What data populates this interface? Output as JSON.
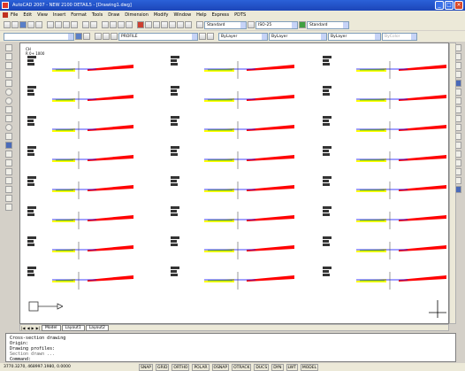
{
  "window": {
    "title": "AutoCAD 2007 - NEW 2100 DETAIL5 - [Drawing1.dwg]"
  },
  "menu": [
    "File",
    "Edit",
    "View",
    "Insert",
    "Format",
    "Tools",
    "Draw",
    "Dimension",
    "Modify",
    "Window",
    "Help",
    "Express",
    "PDTS"
  ],
  "styles": {
    "text_style": "Standard",
    "dim_style": "ISO-25",
    "table_style": "Standard"
  },
  "properties": {
    "layer": "PROFILE",
    "color": "ByLayer",
    "linetype": "ByLayer",
    "lineweight": "ByLayer",
    "plot_style": "ByColor"
  },
  "drawing": {
    "caption_line1": "CH",
    "caption_line2": "R 0+ 1000"
  },
  "layout_tabs": [
    "Model",
    "Layout1",
    "Layout2"
  ],
  "command_history": [
    "Cross-section drawing",
    "Origin:",
    "Drawing profiles:",
    "Section drawn ...",
    "Command:"
  ],
  "status": {
    "coords": "3770.3270, 468997.1980, 0.0000",
    "toggles": [
      "SNAP",
      "GRID",
      "ORTHO",
      "POLAR",
      "OSNAP",
      "OTRACK",
      "DUCS",
      "DYN",
      "LWT",
      "MODEL"
    ]
  },
  "colors": {
    "cut": "#ff0000",
    "fill": "#ffff00",
    "ground": "#00aa00",
    "design": "#0000ff"
  }
}
